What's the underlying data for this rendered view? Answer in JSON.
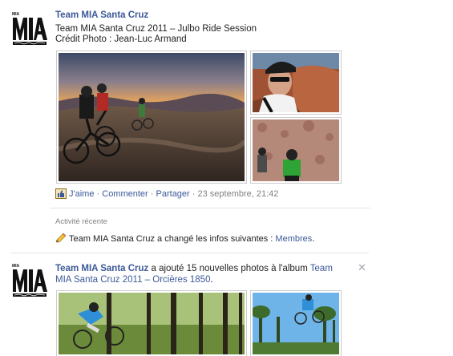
{
  "post1": {
    "author": "Team MIA Santa Cruz",
    "line1": "Team MIA Santa Cruz 2011 – Julbo Ride Session",
    "line2": "Crédit Photo : Jean-Luc Armand",
    "actions": {
      "like": "J'aime",
      "comment": "Commenter",
      "share": "Partager",
      "timestamp": "23 septembre, 21:42"
    }
  },
  "recent": {
    "title": "Activité récente",
    "text": "Team MIA Santa Cruz a changé les infos suivantes : ",
    "link": "Membres"
  },
  "post2": {
    "author": "Team MIA Santa Cruz",
    "text": " a ajouté 15 nouvelles photos à l'album ",
    "album": "Team MIA Santa Cruz 2011 – Orcières 1850"
  },
  "colors": {
    "link": "#3b5998",
    "muted": "#808080",
    "separator": "#e5e5e5"
  }
}
